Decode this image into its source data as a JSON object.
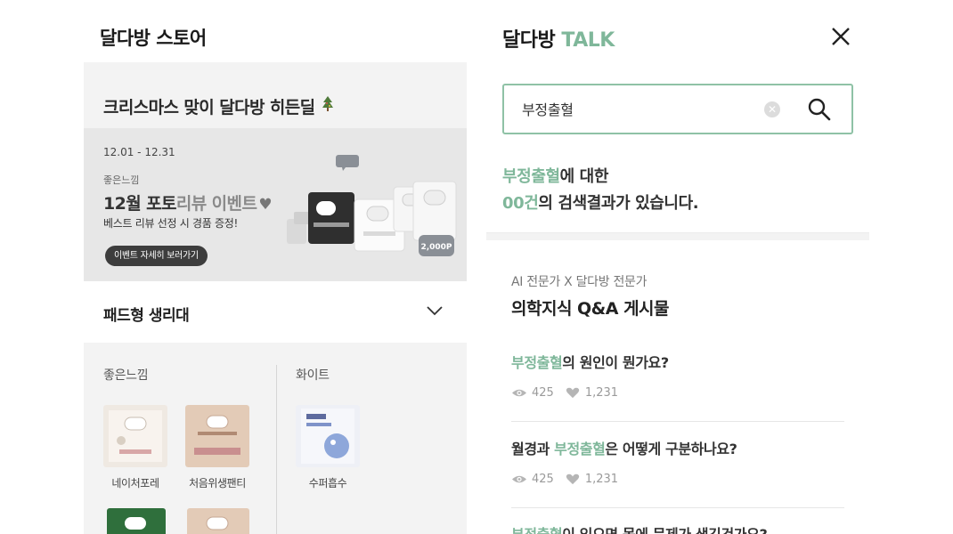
{
  "store": {
    "title": "달다방 스토어",
    "promo_title": "크리스마스 맞이 달다방 히든딜",
    "banner": {
      "date": "12.01 - 12.31",
      "brand": "좋은느낌",
      "headline_bold": "12월 포토",
      "headline_light": "리뷰 이벤트",
      "subtext": "베스트 리뷰 선정 시 경품 증정!",
      "button": "이벤트 자세히 보러가기",
      "badge": "2,000P"
    },
    "category": "패드형 생리대",
    "brands": [
      {
        "name": "좋은느낌",
        "products": [
          "네이처포레",
          "처음위생팬티"
        ]
      },
      {
        "name": "화이트",
        "products": [
          "수퍼흡수"
        ]
      }
    ]
  },
  "talk": {
    "title_main": "달다방",
    "title_accent": "TALK",
    "search": {
      "value": "부정출혈"
    },
    "result": {
      "keyword": "부정출혈",
      "line1_suffix": "에 대한",
      "count": "00건",
      "line2_suffix": "의 검색결과가 있습니다."
    },
    "qa_subtitle": "AI 전문가 X 달다방 전문가",
    "qa_title": "의학지식 Q&A 게시물",
    "questions": [
      {
        "prefix": "",
        "keyword": "부정출혈",
        "suffix": "의 원인이 뭔가요?",
        "views": "425",
        "likes": "1,231"
      },
      {
        "prefix": "월경과 ",
        "keyword": "부정출혈",
        "suffix": "은 어떻게 구분하나요?",
        "views": "425",
        "likes": "1,231"
      },
      {
        "prefix": "",
        "keyword": "부정출혈",
        "suffix": "이 있으면 몸에 문제가 생긴건가요?",
        "views": "",
        "likes": ""
      }
    ]
  },
  "colors": {
    "accent": "#7fb79a",
    "search_border": "#8fc2a6",
    "panel_bg": "#f3f3f3"
  },
  "icons": [
    "tree-icon",
    "heart-icon",
    "chevron-down-icon",
    "close-icon",
    "clear-icon",
    "search-icon",
    "eye-icon"
  ]
}
